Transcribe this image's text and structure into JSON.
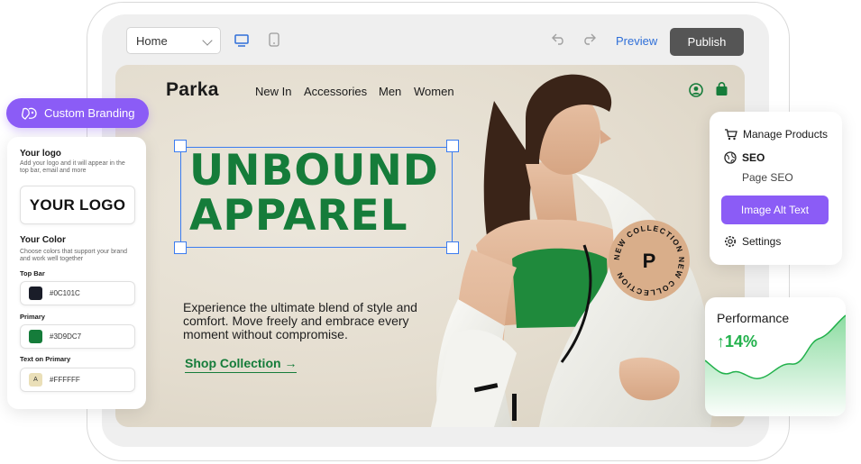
{
  "toolbar": {
    "page_select_value": "Home",
    "preview_label": "Preview",
    "publish_label": "Publish"
  },
  "site": {
    "brand": "Parka",
    "nav": [
      "New In",
      "Accessories",
      "Men",
      "Women"
    ],
    "headline_line1": "UNBOUND",
    "headline_line2": "APPAREL",
    "body_copy": "Experience the ultimate blend of style and comfort. Move freely and embrace every moment without compromise.",
    "cta_label": "Shop Collection",
    "cta_arrow": "→",
    "stamp_letter": "P",
    "stamp_ring_text": "NEW COLLECTION NEW COLLECTION"
  },
  "branding": {
    "pill_label": "Custom Branding",
    "logo_title": "Your logo",
    "logo_sub": "Add your logo and it will appear in the top bar, email and more",
    "logo_placeholder": "YOUR LOGO",
    "color_title": "Your Color",
    "color_sub": "Choose colors that support your brand and work well together",
    "colors": [
      {
        "label": "Top Bar",
        "value": "#0C101C",
        "swatch": "#1a1d29",
        "glyph": ""
      },
      {
        "label": "Primary",
        "value": "#3D9DC7",
        "swatch": "#157c3a",
        "glyph": ""
      },
      {
        "label": "Text on Primary",
        "value": "#FFFFFF",
        "swatch": "#eadfb8",
        "glyph": "A"
      }
    ]
  },
  "menu": {
    "manage_products": "Manage Products",
    "seo": "SEO",
    "page_seo": "Page SEO",
    "image_alt_text": "Image Alt Text",
    "settings": "Settings"
  },
  "performance": {
    "title": "Performance",
    "arrow": "↑",
    "value": "14%"
  },
  "colors": {
    "accent_purple": "#8b5cf6",
    "brand_green": "#157c3a",
    "publish_gray": "#555555",
    "selection_blue": "#3b7cf0"
  }
}
